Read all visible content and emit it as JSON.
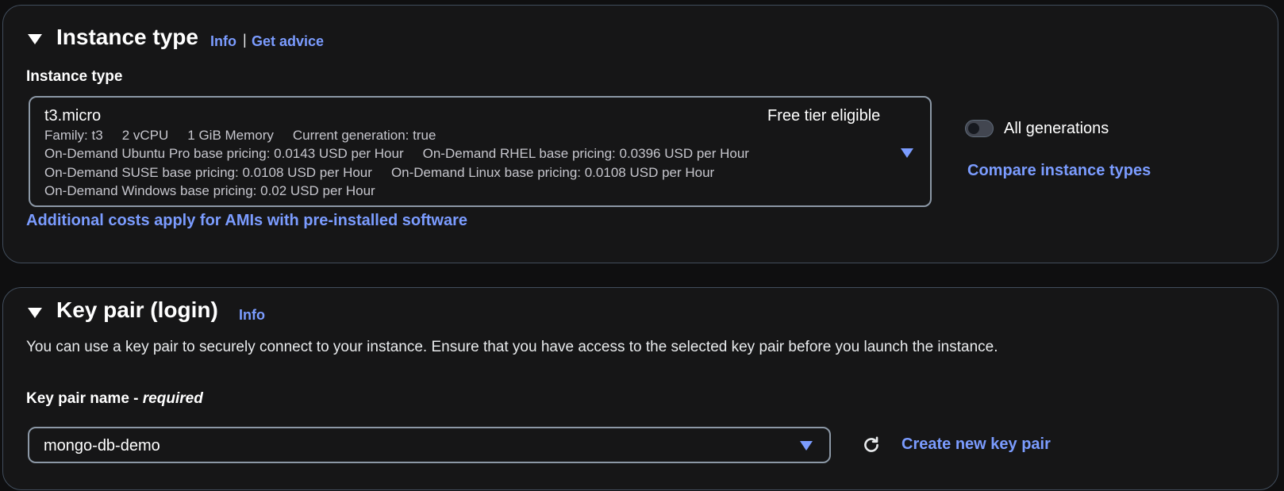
{
  "instance_type": {
    "title": "Instance type",
    "info_link": "Info",
    "separator": "|",
    "advice_link": "Get advice",
    "field_label": "Instance type",
    "selected": "t3.micro",
    "badge": "Free tier eligible",
    "meta": {
      "family": "Family: t3",
      "vcpu": "2 vCPU",
      "memory": "1 GiB Memory",
      "generation": "Current generation: true",
      "ubuntu_pro": "On-Demand Ubuntu Pro base pricing: 0.0143 USD per Hour",
      "rhel": "On-Demand RHEL base pricing: 0.0396 USD per Hour",
      "suse": "On-Demand SUSE base pricing: 0.0108 USD per Hour",
      "linux": "On-Demand Linux base pricing: 0.0108 USD per Hour",
      "windows": "On-Demand Windows base pricing: 0.02 USD per Hour"
    },
    "toggle_label": "All generations",
    "toggle_on": false,
    "compare_link": "Compare instance types",
    "additional_costs_link": "Additional costs apply for AMIs with pre-installed software"
  },
  "key_pair": {
    "title": "Key pair (login)",
    "info_link": "Info",
    "description": "You can use a key pair to securely connect to your instance. Ensure that you have access to the selected key pair before you launch the instance.",
    "field_label": "Key pair name - ",
    "field_required": "required",
    "selected": "mongo-db-demo",
    "create_link": "Create new key pair"
  },
  "colors": {
    "accent": "#7b9cff",
    "background": "#0f0f10",
    "panel": "#161617",
    "border": "#414d5c"
  },
  "icons": {
    "collapse": "caret-down-icon",
    "dropdown": "dropdown-arrow-icon",
    "refresh": "refresh-icon"
  }
}
